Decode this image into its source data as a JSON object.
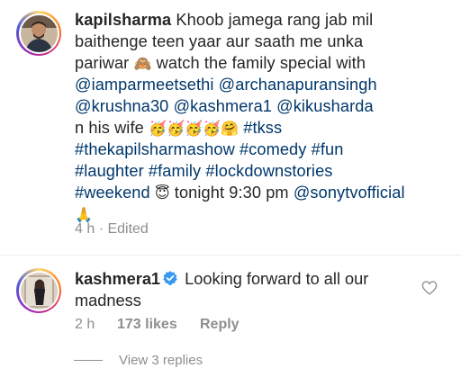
{
  "post": {
    "username": "kapilsharma",
    "text_1": " Khoob jamega rang jab mil",
    "text_2": "baithenge teen yaar aur saath me unka",
    "text_3a": "pariwar ",
    "emoji_monkey": "🙈",
    "text_3b": " watch the family special with",
    "mention_1": "@iamparmeetsethi",
    "mention_2": "@archanapuransingh",
    "mention_3": "@krushna30",
    "mention_4": "@kashmera1",
    "mention_5": "@kikusharda",
    "text_6a": "n his wife ",
    "emoji_party": "🥳🥳🥳🥳🤗",
    "hashtag_1": "#tkss",
    "hashtag_2": "#thekapilsharmashow",
    "hashtag_3": "#comedy",
    "hashtag_4": "#fun",
    "hashtag_5": "#laughter",
    "hashtag_6": "#family",
    "hashtag_7": "#lockdownstories",
    "hashtag_8": "#weekend",
    "emoji_halo": "😇",
    "text_9b": " tonight 9:30 pm ",
    "mention_6": "@sonytvofficial",
    "emoji_pray": "🙏",
    "meta": "4 h · Edited"
  },
  "comment": {
    "username": "kashmera1",
    "text": "Looking forward to all our madness",
    "time": "2 h",
    "likes": "173 likes",
    "reply_label": "Reply",
    "view_replies": "View 3 replies"
  },
  "icons": {
    "verified": "verified-badge-icon",
    "like": "heart-outline-icon"
  },
  "colors": {
    "link": "#00376b",
    "verified": "#3897f0",
    "muted": "#8e8e8e"
  }
}
